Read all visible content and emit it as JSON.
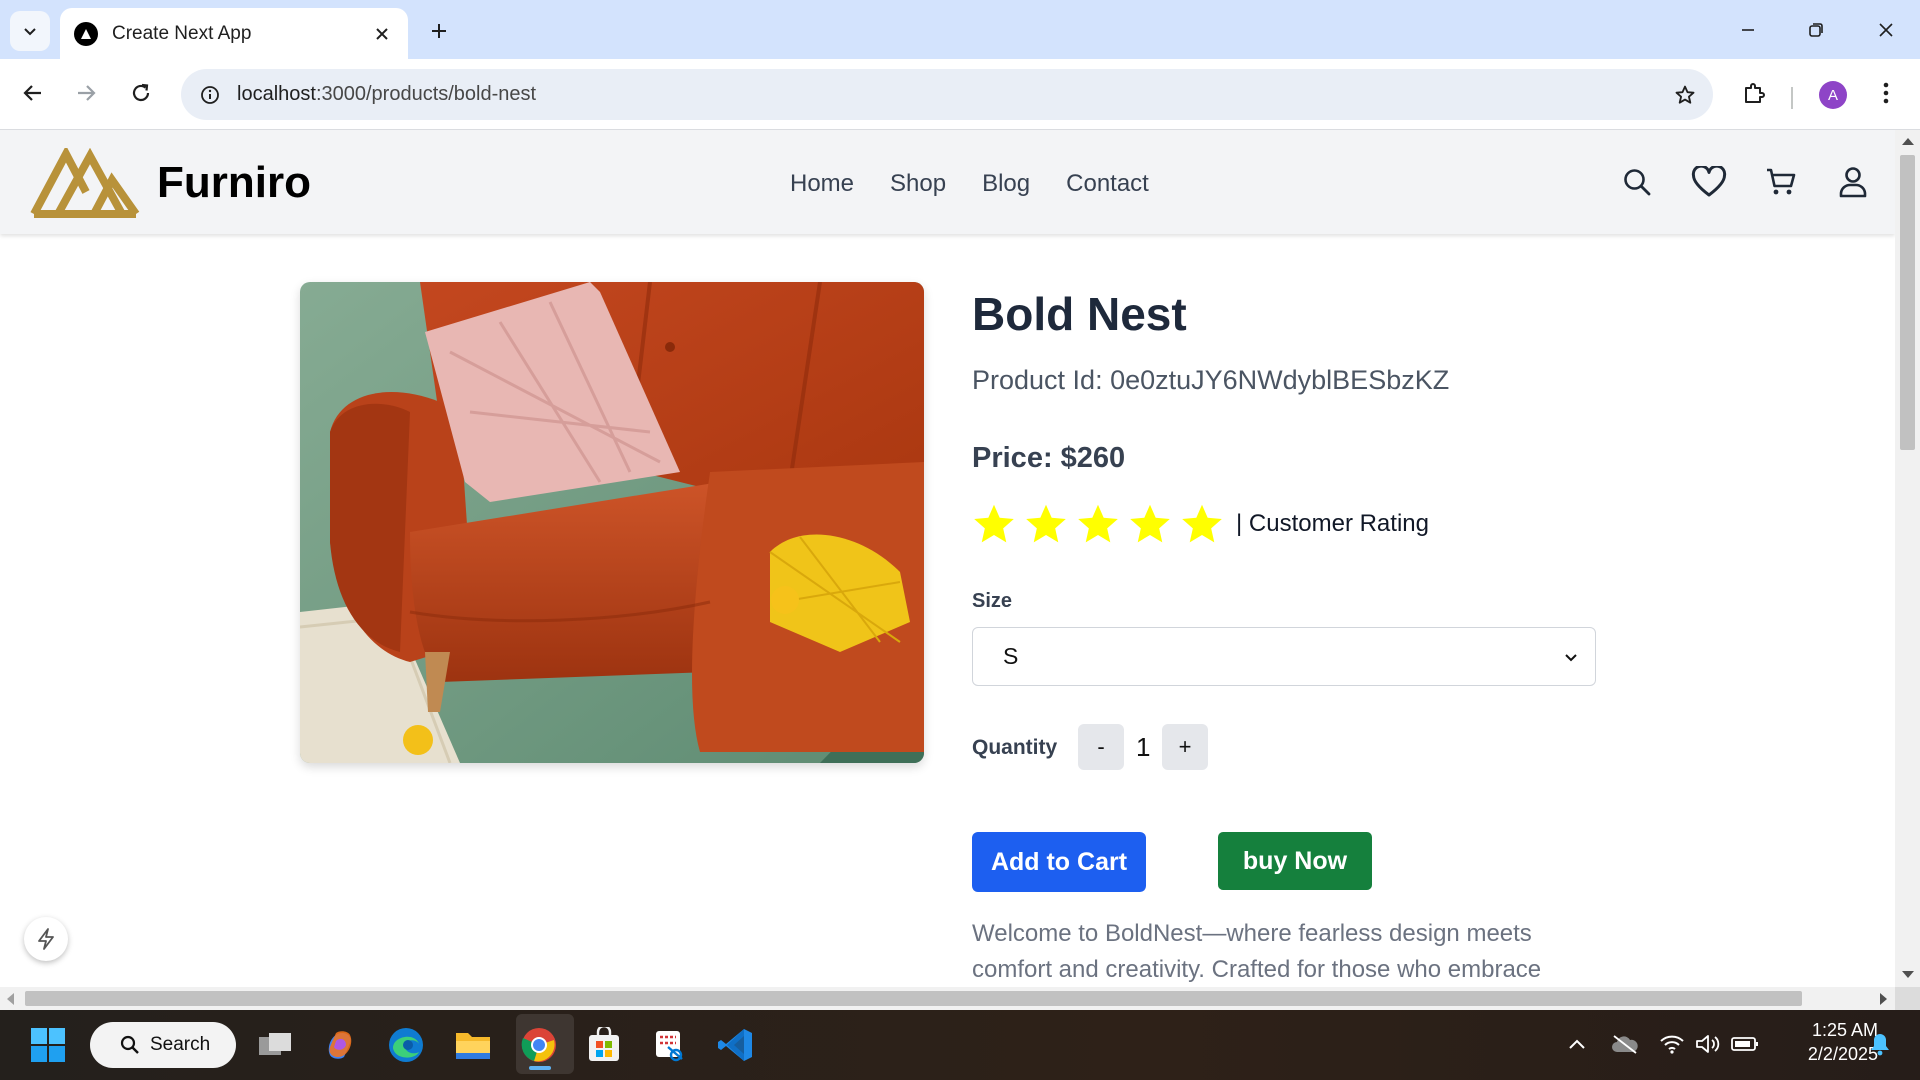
{
  "browser": {
    "tab_title": "Create Next App",
    "url_host": "localhost",
    "url_rest": ":3000/products/bold-nest",
    "profile_initial": "A"
  },
  "site": {
    "brand": "Furniro",
    "nav": [
      "Home",
      "Shop",
      "Blog",
      "Contact"
    ],
    "colors": {
      "brand_gold": "#b8923a",
      "header_bg": "#f3f4f6"
    }
  },
  "product": {
    "title": "Bold Nest",
    "id_line": "Product Id: 0e0ztuJY6NWdyblBESbzKZ",
    "price_line": "Price: $260",
    "rating": 5,
    "rating_max": 5,
    "rating_label": "| Customer Rating",
    "size_label": "Size",
    "size_value": "S",
    "quantity_label": "Quantity",
    "quantity_minus": "-",
    "quantity_value": "1",
    "quantity_plus": "+",
    "add_to_cart": "Add to Cart",
    "buy_now": "buy Now",
    "description": "Welcome to BoldNest—where fearless design meets comfort and creativity. Crafted for those who embrace individuality",
    "colors": {
      "add_to_cart": "#1d5ff0",
      "buy_now": "#15803d",
      "star": "#ffff00"
    }
  },
  "taskbar": {
    "search_label": "Search",
    "time": "1:25 AM",
    "date": "2/2/2025"
  }
}
